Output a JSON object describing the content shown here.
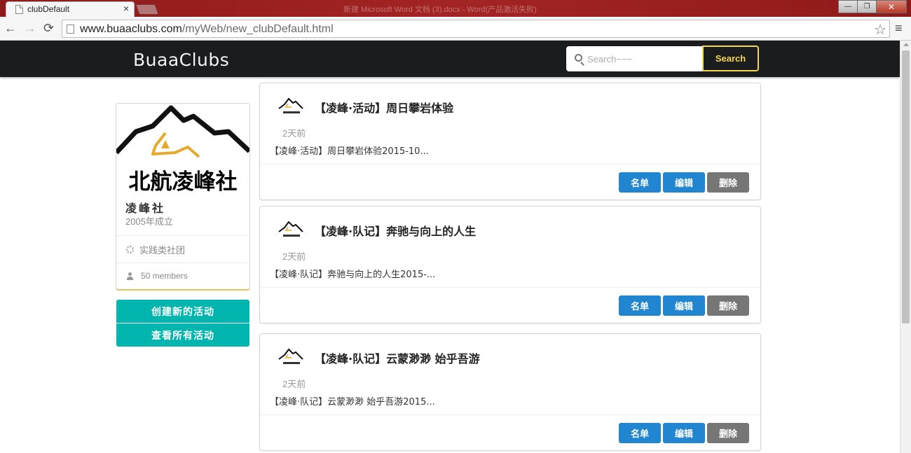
{
  "browser": {
    "tab_title": "clubDefault",
    "tab_close": "×",
    "window_title": "新建 Microsoft Word 文档 (3).docx - Word(产品激活失败)",
    "url_host": "www.buaaclubs.com",
    "url_path": "/myWeb/new_clubDefault.html",
    "back": "←",
    "forward": "→",
    "reload": "⟳",
    "star": "☆",
    "menu": "≡",
    "win_minimize": "—",
    "win_maximize": "❐",
    "win_close": "✕"
  },
  "site": {
    "brand": "BuaaClubs",
    "search_placeholder": "Search~~~",
    "search_button": "Search"
  },
  "club": {
    "logo_text": "北航凌峰社",
    "name": "凌峰社",
    "founded": "2005年成立",
    "type": "实践类社团",
    "members": "50 members"
  },
  "sidebar_buttons": {
    "create": "创建新的活动",
    "view_all": "查看所有活动"
  },
  "activities": [
    {
      "title": "【凌峰·活动】周日攀岩体验",
      "time": "2天前",
      "summary": "【凌峰·活动】周日攀岩体验2015-10...",
      "btn_list": "名单",
      "btn_edit": "编辑",
      "btn_delete": "删除"
    },
    {
      "title": "【凌峰·队记】奔驰与向上的人生",
      "time": "2天前",
      "summary": "【凌峰·队记】奔驰与向上的人生2015-...",
      "btn_list": "名单",
      "btn_edit": "编辑",
      "btn_delete": "删除"
    },
    {
      "title": "【凌峰·队记】云蒙渺渺 始乎吾游",
      "time": "2天前",
      "summary": "【凌峰·队记】云蒙渺渺 始乎吾游2015...",
      "btn_list": "名单",
      "btn_edit": "编辑",
      "btn_delete": "删除"
    }
  ],
  "colors": {
    "navbar": "#1b1c1d",
    "search_accent": "#f5d64e",
    "teal": "#00b5ad",
    "blue": "#2185d0",
    "grey": "#767676"
  }
}
